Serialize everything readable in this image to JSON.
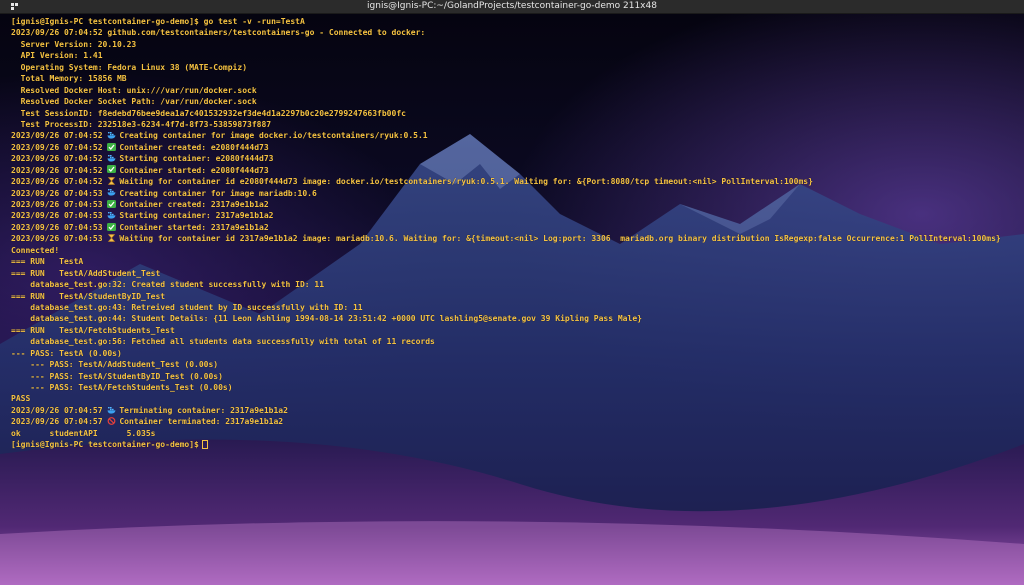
{
  "window": {
    "title": "ignis@Ignis-PC:~/GolandProjects/testcontainer-go-demo 211x48"
  },
  "colors": {
    "text": "#f5c242",
    "titlebar": "#2b2b2b"
  },
  "terminal": {
    "lines": [
      {
        "text": "[ignis@Ignis-PC testcontainer-go-demo]$ go test -v -run=TestA"
      },
      {
        "text": "2023/09/26 07:04:52 github.com/testcontainers/testcontainers-go - Connected to docker:"
      },
      {
        "text": "  Server Version: 20.10.23"
      },
      {
        "text": "  API Version: 1.41"
      },
      {
        "text": "  Operating System: Fedora Linux 38 (MATE-Compiz)"
      },
      {
        "text": "  Total Memory: 15856 MB"
      },
      {
        "text": "  Resolved Docker Host: unix:///var/run/docker.sock"
      },
      {
        "text": "  Resolved Docker Socket Path: /var/run/docker.sock"
      },
      {
        "text": "  Test SessionID: f8edebd76bee9dea1a7c401532932ef3de4d1a2297b0c20e2799247663fb00fc"
      },
      {
        "text": "  Test ProcessID: 232518e3-6234-4f7d-8f73-53859873f887"
      },
      {
        "prefix": "2023/09/26 07:04:52",
        "icon": "whale-icon",
        "text": "Creating container for image docker.io/testcontainers/ryuk:0.5.1"
      },
      {
        "prefix": "2023/09/26 07:04:52",
        "icon": "check-icon",
        "text": "Container created: e2080f444d73"
      },
      {
        "prefix": "2023/09/26 07:04:52",
        "icon": "whale-icon",
        "text": "Starting container: e2080f444d73"
      },
      {
        "prefix": "2023/09/26 07:04:52",
        "icon": "check-icon",
        "text": "Container started: e2080f444d73"
      },
      {
        "prefix": "2023/09/26 07:04:52",
        "icon": "hourglass-icon",
        "text": "Waiting for container id e2080f444d73 image: docker.io/testcontainers/ryuk:0.5.1. Waiting for: &{Port:8080/tcp timeout:<nil> PollInterval:100ms}"
      },
      {
        "prefix": "2023/09/26 07:04:53",
        "icon": "whale-icon",
        "text": "Creating container for image mariadb:10.6"
      },
      {
        "prefix": "2023/09/26 07:04:53",
        "icon": "check-icon",
        "text": "Container created: 2317a9e1b1a2"
      },
      {
        "prefix": "2023/09/26 07:04:53",
        "icon": "whale-icon",
        "text": "Starting container: 2317a9e1b1a2"
      },
      {
        "prefix": "2023/09/26 07:04:53",
        "icon": "check-icon",
        "text": "Container started: 2317a9e1b1a2"
      },
      {
        "prefix": "2023/09/26 07:04:53",
        "icon": "hourglass-icon",
        "text": "Waiting for container id 2317a9e1b1a2 image: mariadb:10.6. Waiting for: &{timeout:<nil> Log:port: 3306  mariadb.org binary distribution IsRegexp:false Occurrence:1 PollInterval:100ms}"
      },
      {
        "text": "Connected!"
      },
      {
        "text": "=== RUN   TestA"
      },
      {
        "text": "=== RUN   TestA/AddStudent_Test"
      },
      {
        "text": "    database_test.go:32: Created student successfully with ID: 11"
      },
      {
        "text": "=== RUN   TestA/StudentByID_Test"
      },
      {
        "text": "    database_test.go:43: Retreived student by ID successfully with ID: 11"
      },
      {
        "text": "    database_test.go:44: Student Details: {11 Leon Ashling 1994-08-14 23:51:42 +0000 UTC lashling5@senate.gov 39 Kipling Pass Male}"
      },
      {
        "text": "=== RUN   TestA/FetchStudents_Test"
      },
      {
        "text": "    database_test.go:56: Fetched all students data successfully with total of 11 records"
      },
      {
        "text": "--- PASS: TestA (0.00s)"
      },
      {
        "text": "    --- PASS: TestA/AddStudent_Test (0.00s)"
      },
      {
        "text": "    --- PASS: TestA/StudentByID_Test (0.00s)"
      },
      {
        "text": "    --- PASS: TestA/FetchStudents_Test (0.00s)"
      },
      {
        "text": "PASS"
      },
      {
        "prefix": "2023/09/26 07:04:57",
        "icon": "whale-icon",
        "text": "Terminating container: 2317a9e1b1a2"
      },
      {
        "prefix": "2023/09/26 07:04:57",
        "icon": "prohibited-icon",
        "text": "Container terminated: 2317a9e1b1a2"
      },
      {
        "text": "ok      studentAPI      5.035s"
      },
      {
        "text": "[ignis@Ignis-PC testcontainer-go-demo]$",
        "cursor": true
      }
    ]
  }
}
